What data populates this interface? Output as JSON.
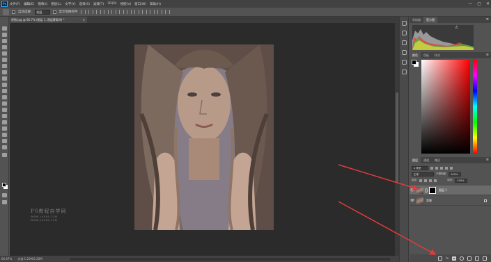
{
  "app": {
    "logo": "Ps"
  },
  "menubar": {
    "items": [
      "文件(F)",
      "编辑(E)",
      "图像(I)",
      "图层(L)",
      "文字(Y)",
      "选择(S)",
      "滤镜(T)",
      "3D(D)",
      "视图(V)",
      "窗口(W)",
      "帮助(H)"
    ],
    "window_controls": [
      "—",
      "▢",
      "✕"
    ]
  },
  "options_bar": {
    "auto_select_label": "自动选择:",
    "auto_select_value": "图层",
    "show_transform_label": "显示变换控件"
  },
  "document_tab": {
    "title": "原图.jpg @ 66.7% (图层 1, 图层蒙版/8) *",
    "close": "×"
  },
  "canvas": {
    "watermark_main": "PS教程自学网",
    "watermark_sub1": "WWW.16XX8.COM",
    "watermark_sub2": "WWW.16XX8.COM"
  },
  "status_bar": {
    "zoom": "66.67%",
    "doc_info": "文档:1.20M/2.26M"
  },
  "panels": {
    "histogram_tabs": [
      "导航器",
      "直方图"
    ],
    "color_tabs": [
      "颜色",
      "色板",
      "样式"
    ],
    "layers_tabs": [
      "图层",
      "通道",
      "路径"
    ],
    "filter_label": "ρ 类型",
    "blend_mode": "正常",
    "opacity_label": "不透明度:",
    "opacity_value": "100%",
    "lock_label": "锁定:",
    "fill_label": "填充:",
    "fill_value": "100%",
    "layers": [
      {
        "name": "图层 1",
        "selected": true,
        "has_mask": true
      },
      {
        "name": "背景",
        "selected": false,
        "has_mask": false
      }
    ],
    "bottom_icons": [
      "link-icon",
      "fx-icon",
      "add-mask-icon",
      "adjustment-icon",
      "folder-icon",
      "new-layer-icon",
      "trash-icon"
    ],
    "bottom_fx": "fx",
    "menu_glyph": "≡"
  },
  "colors": {
    "annotation_arrow": "#e23b3b",
    "canvas_bg": "#2b2b2b",
    "ui_bg": "#535353"
  },
  "icons": {
    "eye": "👁",
    "warning": "⚠"
  }
}
